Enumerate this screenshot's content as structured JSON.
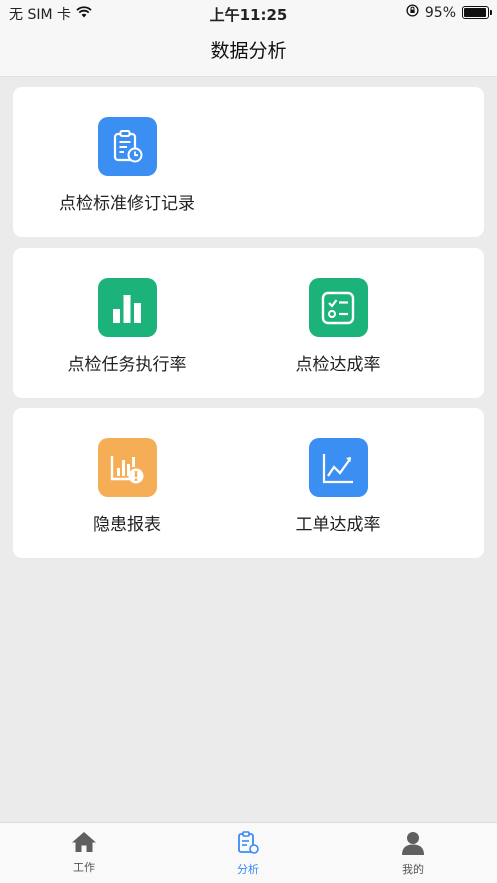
{
  "status_bar": {
    "carrier": "无 SIM 卡",
    "time": "上午11:25",
    "battery": "95%"
  },
  "nav": {
    "title": "数据分析"
  },
  "cards": [
    {
      "items": [
        {
          "label": "点检标准修订记录",
          "icon": "clipboard-clock-icon",
          "color": "#3b8ff3"
        }
      ]
    },
    {
      "items": [
        {
          "label": "点检任务执行率",
          "icon": "bar-chart-icon",
          "color": "#1bb37a"
        },
        {
          "label": "点检达成率",
          "icon": "checklist-icon",
          "color": "#1bb37a"
        }
      ]
    },
    {
      "items": [
        {
          "label": "隐患报表",
          "icon": "hazard-report-icon",
          "color": "#f5ae56"
        },
        {
          "label": "工单达成率",
          "icon": "line-chart-icon",
          "color": "#3b8ff3"
        }
      ]
    }
  ],
  "tabbar": {
    "items": [
      {
        "label": "工作",
        "icon": "home-icon"
      },
      {
        "label": "分析",
        "icon": "analysis-icon",
        "active": true
      },
      {
        "label": "我的",
        "icon": "person-icon"
      }
    ]
  },
  "colors": {
    "accent": "#3b8af7",
    "green": "#1bb37a",
    "orange": "#f5ae56",
    "blue": "#3b8ff3"
  }
}
